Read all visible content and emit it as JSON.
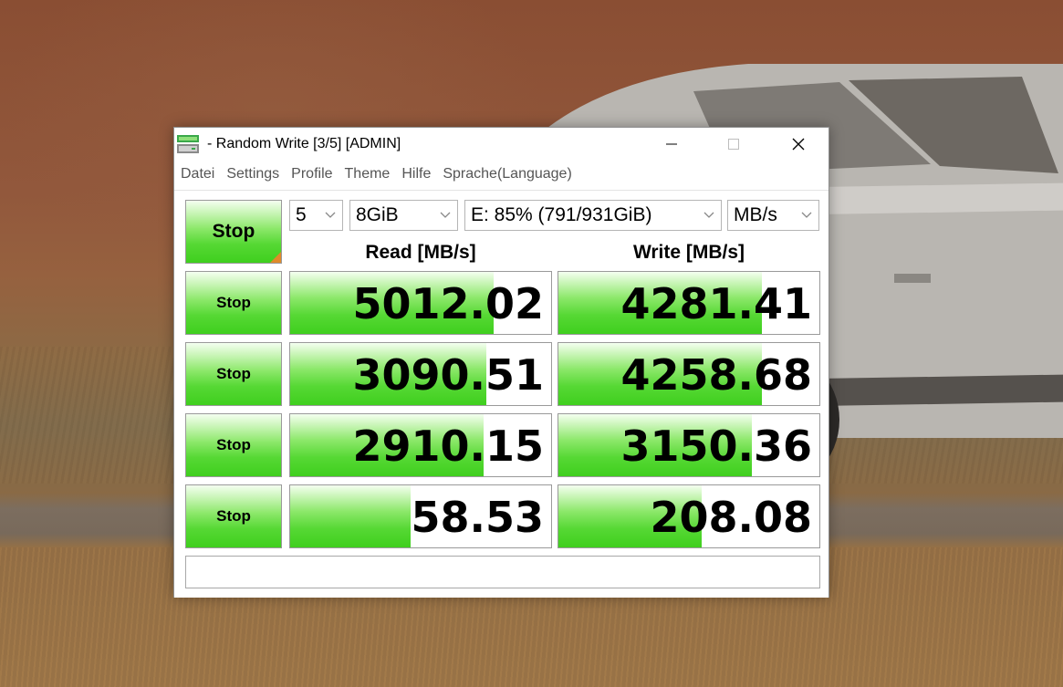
{
  "window": {
    "title": "- Random Write [3/5] [ADMIN]"
  },
  "menu": {
    "items": [
      "Datei",
      "Settings",
      "Profile",
      "Theme",
      "Hilfe",
      "Sprache(Language)"
    ]
  },
  "controls": {
    "main_stop_label": "Stop",
    "count": "5",
    "size": "8GiB",
    "drive": "E: 85% (791/931GiB)",
    "unit": "MB/s"
  },
  "headers": {
    "read": "Read [MB/s]",
    "write": "Write [MB/s]"
  },
  "rows": [
    {
      "stop_label": "Stop",
      "read": "5012.02",
      "write": "4281.41",
      "read_fill": 0.78,
      "write_fill": 0.78
    },
    {
      "stop_label": "Stop",
      "read": "3090.51",
      "write": "4258.68",
      "read_fill": 0.75,
      "write_fill": 0.78
    },
    {
      "stop_label": "Stop",
      "read": "2910.15",
      "write": "3150.36",
      "read_fill": 0.74,
      "write_fill": 0.74
    },
    {
      "stop_label": "Stop",
      "read": "58.53",
      "write": "208.08",
      "read_fill": 0.46,
      "write_fill": 0.55
    }
  ],
  "comment": "",
  "colors": {
    "bar_green": "#56d834",
    "corner_orange": "#e08a2a"
  },
  "icons": {
    "app": "crystaldiskmark-icon",
    "dropdown": "chevron-down-icon"
  }
}
